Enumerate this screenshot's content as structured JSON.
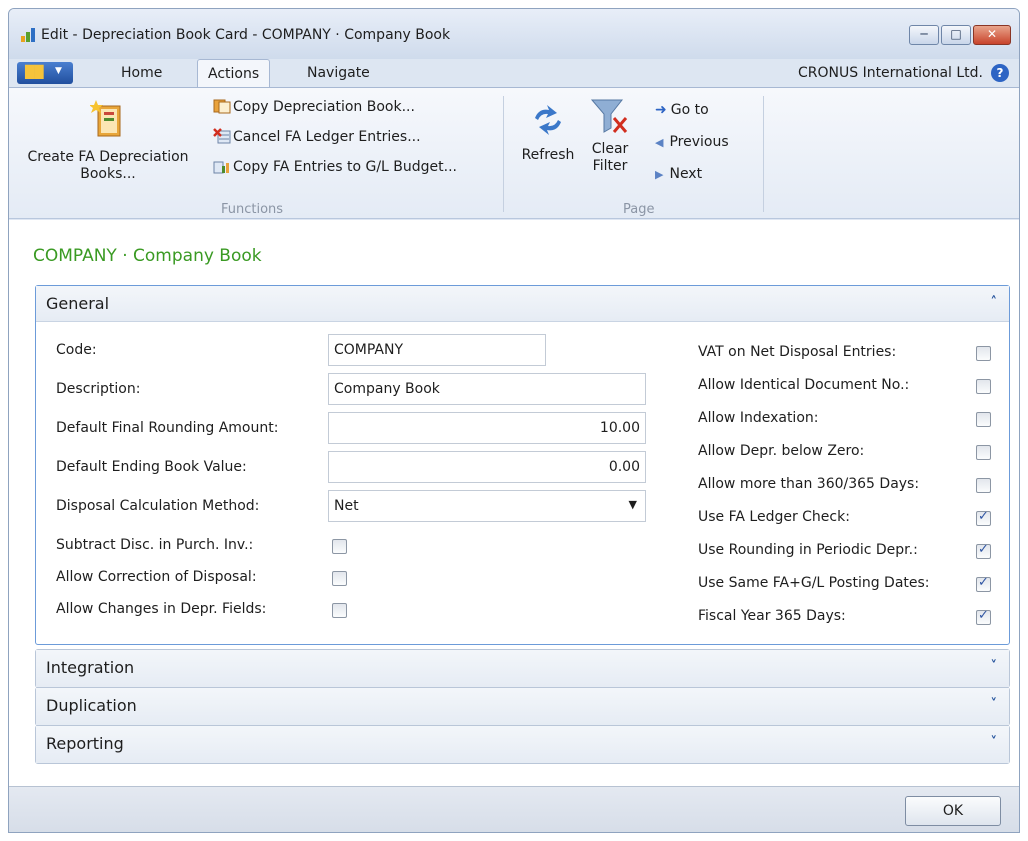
{
  "window": {
    "title": "Edit - Depreciation Book Card - COMPANY · Company Book"
  },
  "ribbon_tabs": {
    "home": "Home",
    "actions": "Actions",
    "navigate": "Navigate"
  },
  "company_name": "CRONUS International Ltd.",
  "ribbon": {
    "create_books": "Create FA Depreciation Books...",
    "copy_book": "Copy Depreciation Book...",
    "cancel_entries": "Cancel FA Ledger Entries...",
    "copy_entries": "Copy FA Entries to G/L Budget...",
    "functions_label": "Functions",
    "refresh": "Refresh",
    "clear_filter": "Clear Filter",
    "go_to": "Go to",
    "previous": "Previous",
    "next": "Next",
    "page_label": "Page"
  },
  "page_title": "COMPANY · Company Book",
  "general": {
    "title": "General",
    "code_label": "Code:",
    "code_value": "COMPANY",
    "description_label": "Description:",
    "description_value": "Company Book",
    "rounding_label": "Default Final Rounding Amount:",
    "rounding_value": "10.00",
    "ending_value_label": "Default Ending Book Value:",
    "ending_value": "0.00",
    "disposal_label": "Disposal Calculation Method:",
    "disposal_value": "Net",
    "subtract_label": "Subtract Disc. in Purch. Inv.:",
    "subtract_checked": false,
    "correction_label": "Allow Correction of Disposal:",
    "correction_checked": false,
    "changes_label": "Allow Changes in Depr. Fields:",
    "changes_checked": false,
    "vat_label": "VAT on Net Disposal Entries:",
    "vat_checked": false,
    "identical_label": "Allow Identical Document No.:",
    "identical_checked": false,
    "indexation_label": "Allow Indexation:",
    "indexation_checked": false,
    "below_zero_label": "Allow Depr. below Zero:",
    "below_zero_checked": false,
    "more_days_label": "Allow more than 360/365 Days:",
    "more_days_checked": false,
    "ledger_check_label": "Use FA Ledger Check:",
    "ledger_check_checked": true,
    "rounding_periodic_label": "Use Rounding in Periodic Depr.:",
    "rounding_periodic_checked": true,
    "same_dates_label": "Use Same FA+G/L Posting Dates:",
    "same_dates_checked": true,
    "fiscal_label": "Fiscal Year 365 Days:",
    "fiscal_checked": true
  },
  "fasttabs": {
    "integration": "Integration",
    "duplication": "Duplication",
    "reporting": "Reporting"
  },
  "ok_label": "OK",
  "icons": {
    "check_mark": "✓",
    "chevron_up": "˄",
    "chevron_down": "˅"
  }
}
